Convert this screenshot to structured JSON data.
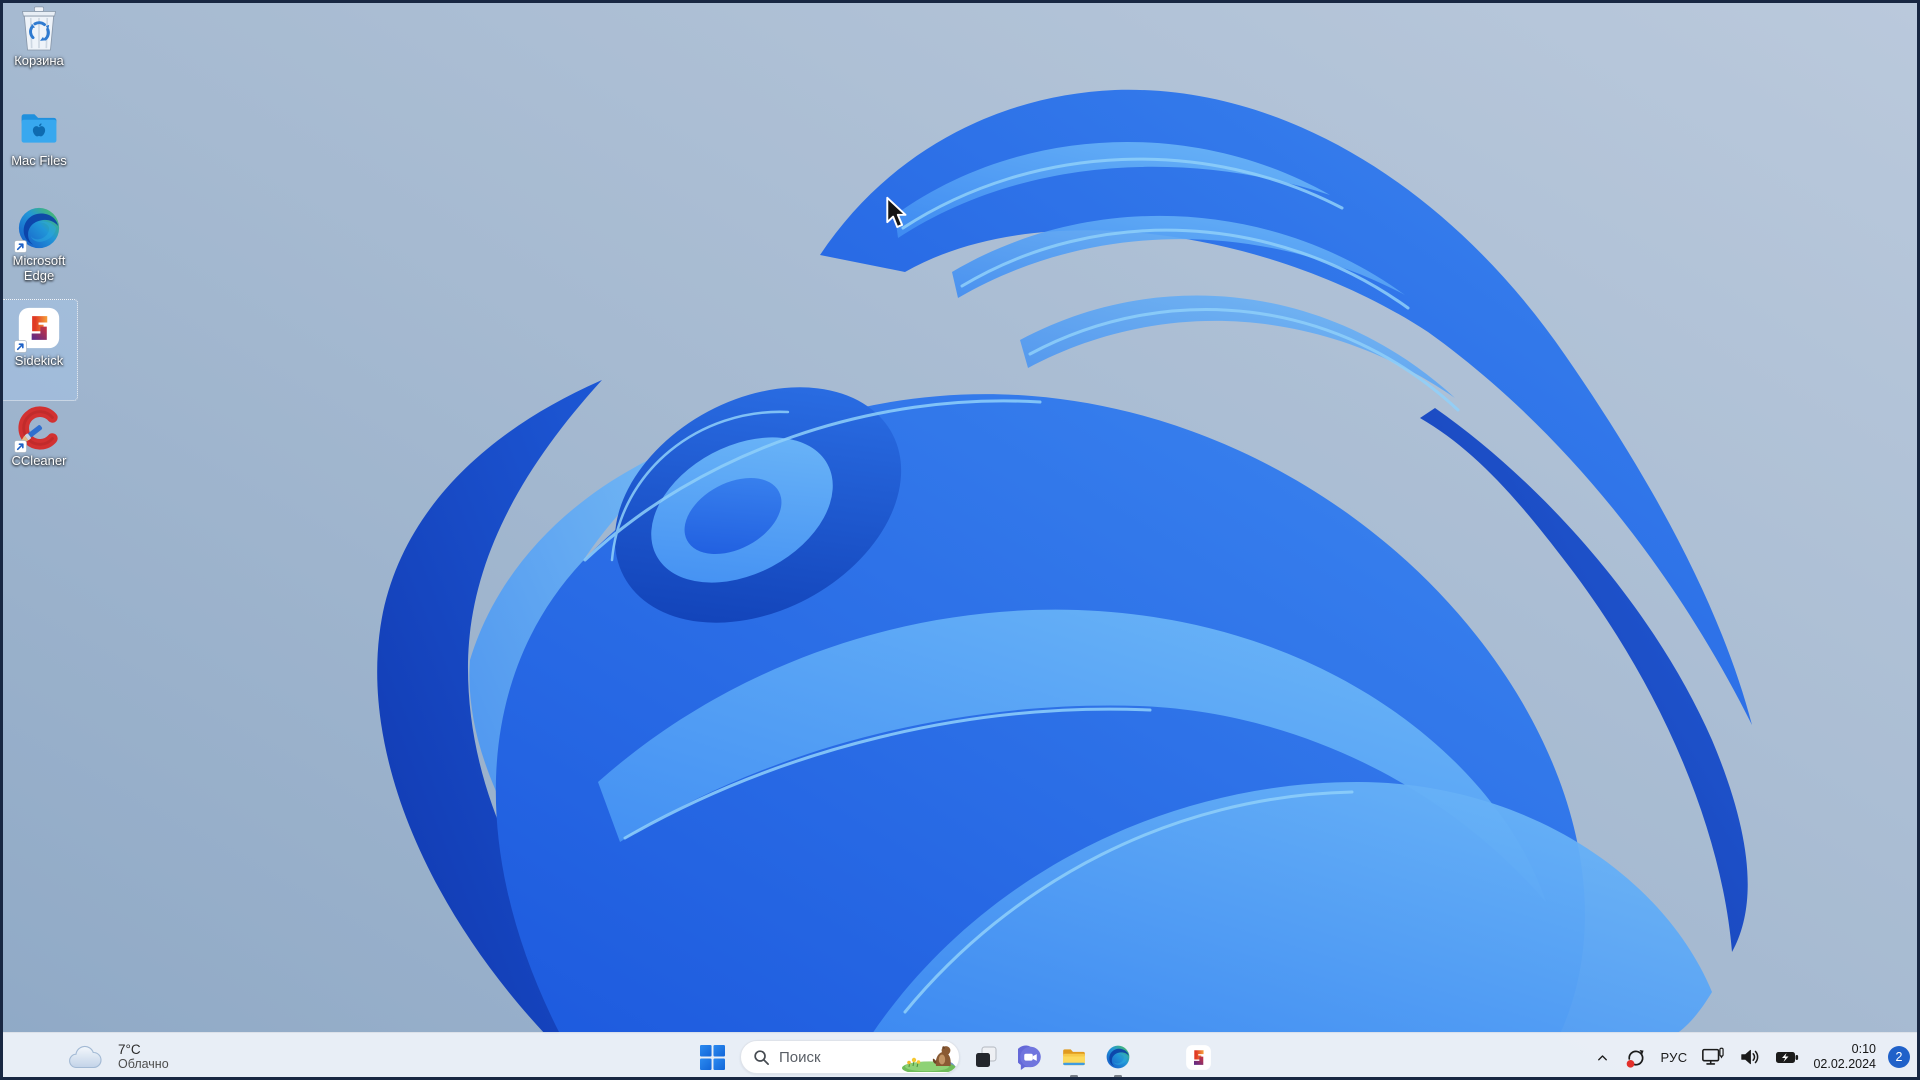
{
  "desktop": {
    "icons": [
      {
        "label": "Корзина",
        "icon": "recycle-bin-icon",
        "selected": false,
        "shortcut": false
      },
      {
        "label": "Mac Files",
        "icon": "mac-files-folder-icon",
        "selected": false,
        "shortcut": false
      },
      {
        "label": "Microsoft Edge",
        "icon": "edge-icon",
        "selected": false,
        "shortcut": true
      },
      {
        "label": "Sidekick",
        "icon": "sidekick-icon",
        "selected": true,
        "shortcut": true
      },
      {
        "label": "CCleaner",
        "icon": "ccleaner-icon",
        "selected": false,
        "shortcut": true
      }
    ]
  },
  "taskbar": {
    "weather": {
      "temperature": "7°C",
      "condition": "Облачно",
      "icon": "cloud-icon"
    },
    "start": {
      "icon": "windows-start-icon"
    },
    "search": {
      "placeholder": "Поиск",
      "icon": "search-icon",
      "highlight_icon": "groundhog-illustration"
    },
    "apps": [
      {
        "icon": "task-view-icon",
        "running": false
      },
      {
        "icon": "chat-icon",
        "running": false
      },
      {
        "icon": "file-explorer-icon",
        "running": true
      },
      {
        "icon": "edge-icon",
        "running": true
      },
      {
        "icon": "sidekick-icon",
        "running": false
      }
    ],
    "tray": {
      "chevron": "chevron-up-icon",
      "sync": "sync-alert-icon",
      "language": "РУС",
      "display": "display-pen-icon",
      "volume": "volume-icon",
      "battery": "battery-charging-icon",
      "time": "0:10",
      "date": "02.02.2024",
      "notifications": "2"
    }
  },
  "colors": {
    "bloom_blue": "#2465e8",
    "bloom_highlight": "#8fd0fa",
    "sky_top": "#b7c7da",
    "sky_bottom": "#8fa9c6",
    "taskbar_bg": "#ebf0f8",
    "accent_blue": "#1a6fe0",
    "badge_blue": "#2061c9",
    "alert_red": "#e3302b"
  }
}
